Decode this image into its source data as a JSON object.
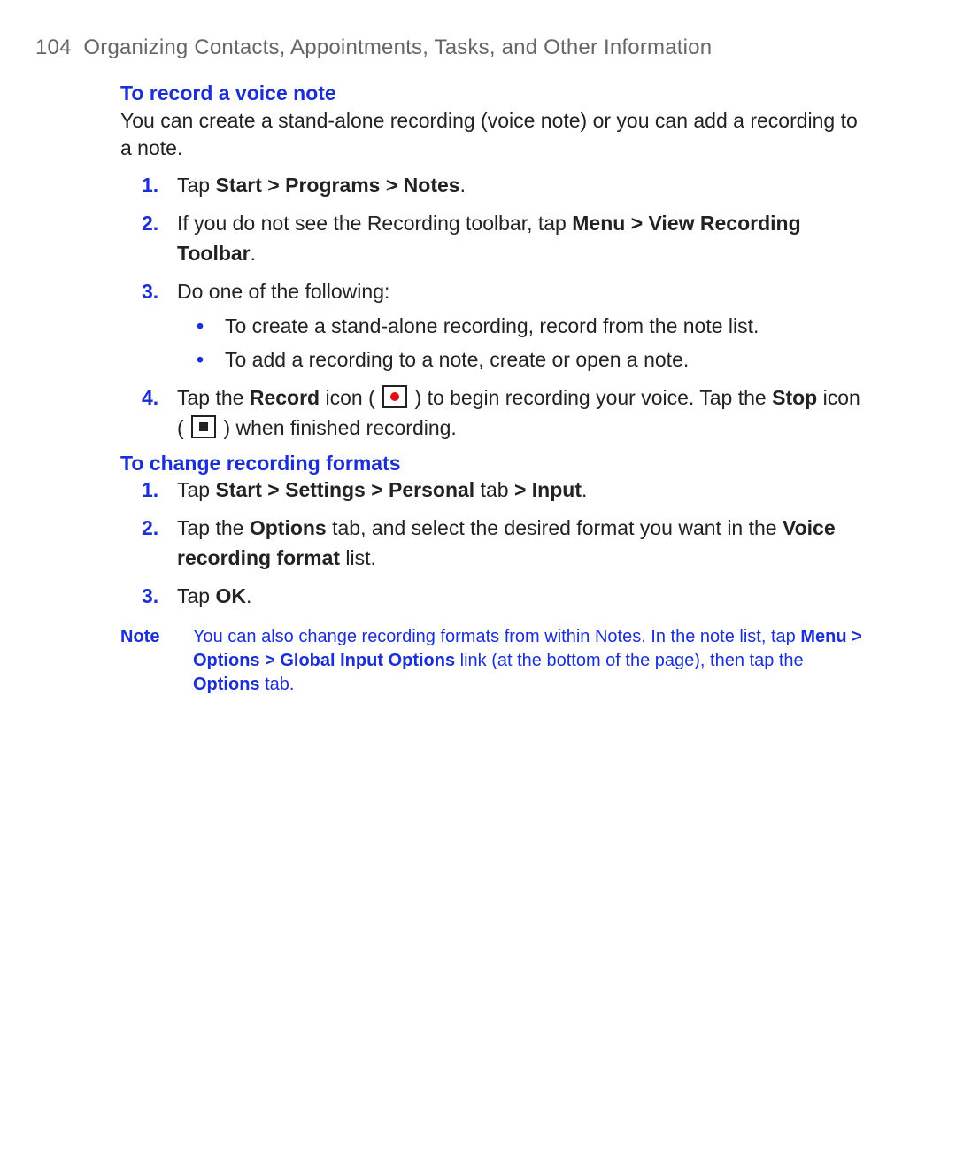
{
  "header": {
    "page_number": "104",
    "chapter_title": "Organizing Contacts, Appointments, Tasks, and Other Information"
  },
  "section1": {
    "heading": "To record a voice note",
    "intro": "You can create a stand-alone recording (voice note) or you can add a recording to a note.",
    "steps": {
      "s1": {
        "num": "1.",
        "pre": "Tap ",
        "b1": "Start > Programs > Notes",
        "post": "."
      },
      "s2": {
        "num": "2.",
        "pre": "If you do not see the Recording toolbar, tap ",
        "b1": "Menu > View Recording Toolbar",
        "post": "."
      },
      "s3": {
        "num": "3.",
        "text": "Do one of the following:",
        "bullets": {
          "b1": "To create a stand-alone recording, record from the note list.",
          "b2": "To add a recording to a note, create or open a note."
        }
      },
      "s4": {
        "num": "4.",
        "pre": "Tap the ",
        "b1": "Record",
        "mid1": " icon ( ",
        "mid2": " ) to begin recording your voice. Tap the ",
        "b2": "Stop",
        "mid3": " icon ( ",
        "mid4": " ) when finished recording."
      }
    }
  },
  "section2": {
    "heading": "To change recording formats",
    "steps": {
      "s1": {
        "num": "1.",
        "pre": "Tap ",
        "b1": "Start > Settings > Personal",
        "mid": " tab ",
        "b2": "> Input",
        "post": "."
      },
      "s2": {
        "num": "2.",
        "pre": "Tap the ",
        "b1": "Options",
        "mid": " tab, and select the desired format you want in the ",
        "b2": "Voice recording format",
        "post": " list."
      },
      "s3": {
        "num": "3.",
        "pre": "Tap ",
        "b1": "OK",
        "post": "."
      }
    }
  },
  "note": {
    "label": "Note",
    "t1": "You can also change recording formats from within Notes. In the note list, tap ",
    "b1": "Menu > Options > Global Input Options",
    "t2": " link (at the bottom of the page), then tap the ",
    "b2": "Options",
    "t3": " tab."
  }
}
